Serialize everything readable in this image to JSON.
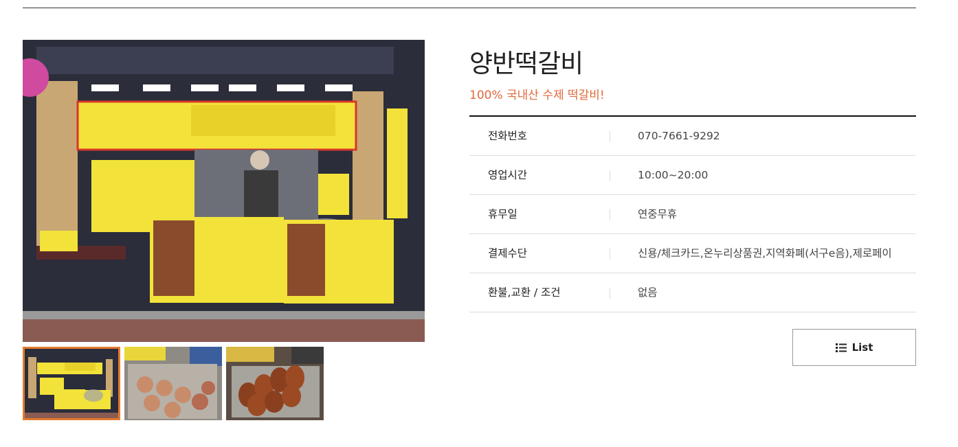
{
  "product": {
    "title": "양반떡갈비",
    "subtitle": "100% 국내산 수제 떡갈비!"
  },
  "info": [
    {
      "label": "전화번호",
      "value": "070-7661-9292"
    },
    {
      "label": "영업시간",
      "value": "10:00~20:00"
    },
    {
      "label": "휴무일",
      "value": "연중무휴"
    },
    {
      "label": "결제수단",
      "value": "신용/체크카드,온누리상품권,지역화폐(서구e음),제로페이"
    },
    {
      "label": "환불,교환 / 조건",
      "value": "없음"
    }
  ],
  "actions": {
    "list_label": "List",
    "list_icon": "list-icon"
  },
  "gallery": {
    "active_index": 0,
    "thumbnails": [
      "storefront",
      "grill-pan",
      "tray-of-patties"
    ]
  },
  "colors": {
    "accent": "#e0693b",
    "thumb_active_border": "#e37a2e",
    "sign_yellow": "#f3e23a"
  }
}
